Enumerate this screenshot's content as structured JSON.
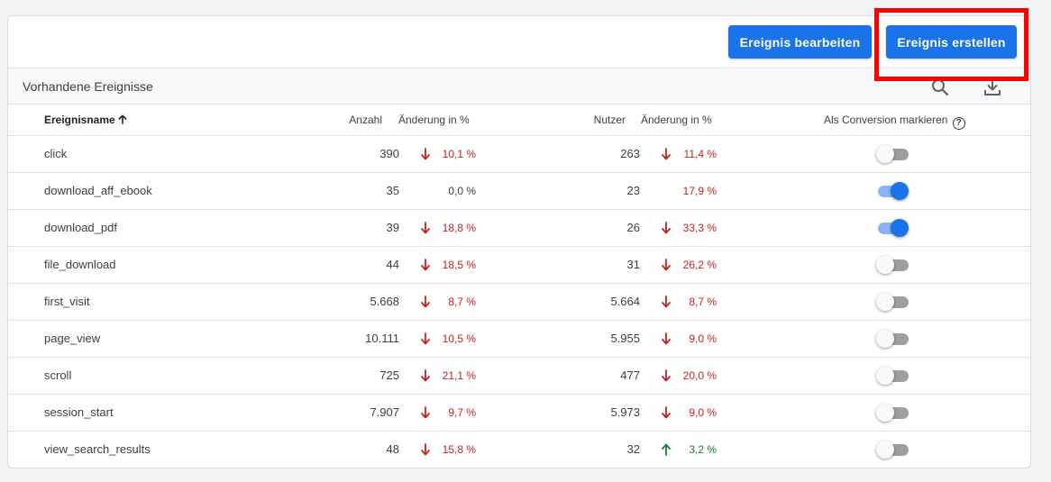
{
  "toolbar": {
    "edit_label": "Ereignis bearbeiten",
    "create_label": "Ereignis erstellen"
  },
  "section": {
    "title": "Vorhandene Ereignisse",
    "search_icon": "search-icon",
    "download_icon": "download-icon"
  },
  "columns": {
    "name": "Ereignisname",
    "count": "Anzahl",
    "count_change": "Änderung in %",
    "users": "Nutzer",
    "users_change": "Änderung in %",
    "conversion": "Als Conversion markieren",
    "help_glyph": "?"
  },
  "colors": {
    "primary": "#1a73e8",
    "negative": "#c5221f",
    "positive": "#188038",
    "highlight": "#ff0000"
  },
  "rows": [
    {
      "name": "click",
      "count": "390",
      "count_dir": "down",
      "count_pct": "10,1 %",
      "users": "263",
      "users_dir": "down",
      "users_pct": "11,4 %",
      "conversion": false
    },
    {
      "name": "download_aff_ebook",
      "count": "35",
      "count_dir": "none",
      "count_pct": "0,0 %",
      "users": "23",
      "users_dir": "none",
      "users_pct": "17,9 %",
      "conversion": true
    },
    {
      "name": "download_pdf",
      "count": "39",
      "count_dir": "down",
      "count_pct": "18,8 %",
      "users": "26",
      "users_dir": "down",
      "users_pct": "33,3 %",
      "conversion": true
    },
    {
      "name": "file_download",
      "count": "44",
      "count_dir": "down",
      "count_pct": "18,5 %",
      "users": "31",
      "users_dir": "down",
      "users_pct": "26,2 %",
      "conversion": false
    },
    {
      "name": "first_visit",
      "count": "5.668",
      "count_dir": "down",
      "count_pct": "8,7 %",
      "users": "5.664",
      "users_dir": "down",
      "users_pct": "8,7 %",
      "conversion": false
    },
    {
      "name": "page_view",
      "count": "10.111",
      "count_dir": "down",
      "count_pct": "10,5 %",
      "users": "5.955",
      "users_dir": "down",
      "users_pct": "9,0 %",
      "conversion": false
    },
    {
      "name": "scroll",
      "count": "725",
      "count_dir": "down",
      "count_pct": "21,1 %",
      "users": "477",
      "users_dir": "down",
      "users_pct": "20,0 %",
      "conversion": false
    },
    {
      "name": "session_start",
      "count": "7.907",
      "count_dir": "down",
      "count_pct": "9,7 %",
      "users": "5.973",
      "users_dir": "down",
      "users_pct": "9,0 %",
      "conversion": false
    },
    {
      "name": "view_search_results",
      "count": "48",
      "count_dir": "down",
      "count_pct": "15,8 %",
      "users": "32",
      "users_dir": "up",
      "users_pct": "3,2 %",
      "conversion": false
    }
  ]
}
